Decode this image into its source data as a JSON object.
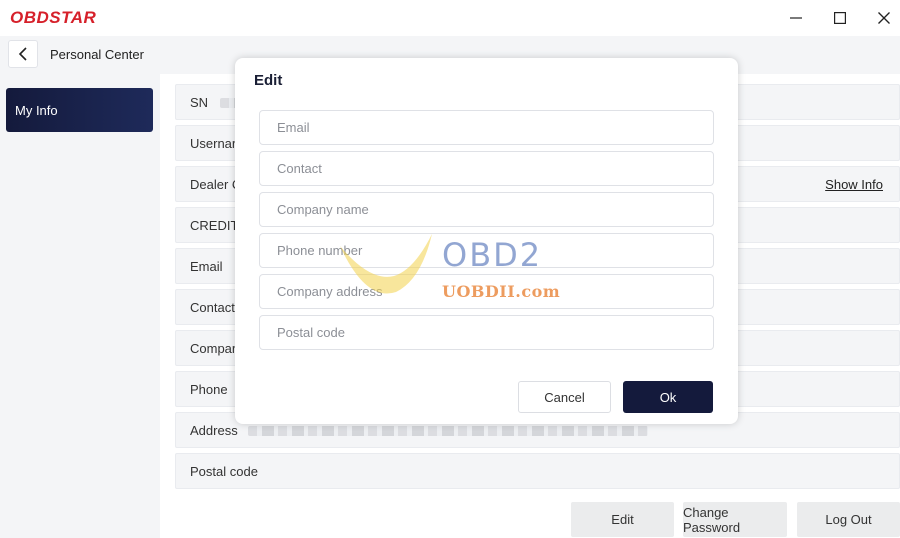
{
  "app": {
    "logo_text": "OBDSTAR"
  },
  "window_controls": {
    "minimize": "minimize-icon",
    "maximize": "maximize-icon",
    "close": "close-icon"
  },
  "header": {
    "back_icon": "chevron-left-icon",
    "title": "Personal Center"
  },
  "sidebar": {
    "items": [
      {
        "label": "My Info",
        "selected": true
      }
    ]
  },
  "info_rows": [
    {
      "label": "SN",
      "blurred": true
    },
    {
      "label": "Usernar"
    },
    {
      "label": "Dealer C",
      "action": "Show Info"
    },
    {
      "label": "CREDIT"
    },
    {
      "label": "Email"
    },
    {
      "label": "Contact"
    },
    {
      "label": "Compar"
    },
    {
      "label": "Phone"
    },
    {
      "label": "Address",
      "blurred": true
    },
    {
      "label": "Postal code"
    }
  ],
  "footer_buttons": {
    "edit": "Edit",
    "change_password": "Change Password",
    "logout": "Log Out"
  },
  "dialog": {
    "title": "Edit",
    "fields": [
      {
        "placeholder": "Email",
        "value": ""
      },
      {
        "placeholder": "Contact",
        "value": ""
      },
      {
        "placeholder": "Company name",
        "value": ""
      },
      {
        "placeholder": "Phone number",
        "value": ""
      },
      {
        "placeholder": "Company address",
        "value": ""
      },
      {
        "placeholder": "Postal code",
        "value": ""
      }
    ],
    "cancel_label": "Cancel",
    "ok_label": "Ok"
  },
  "watermark": {
    "brand": "OBD2",
    "site": "UOBDII.com"
  },
  "colors": {
    "brand_red": "#d6202a",
    "primary_navy": "#141a3c",
    "panel_bg": "#f4f5f7"
  }
}
